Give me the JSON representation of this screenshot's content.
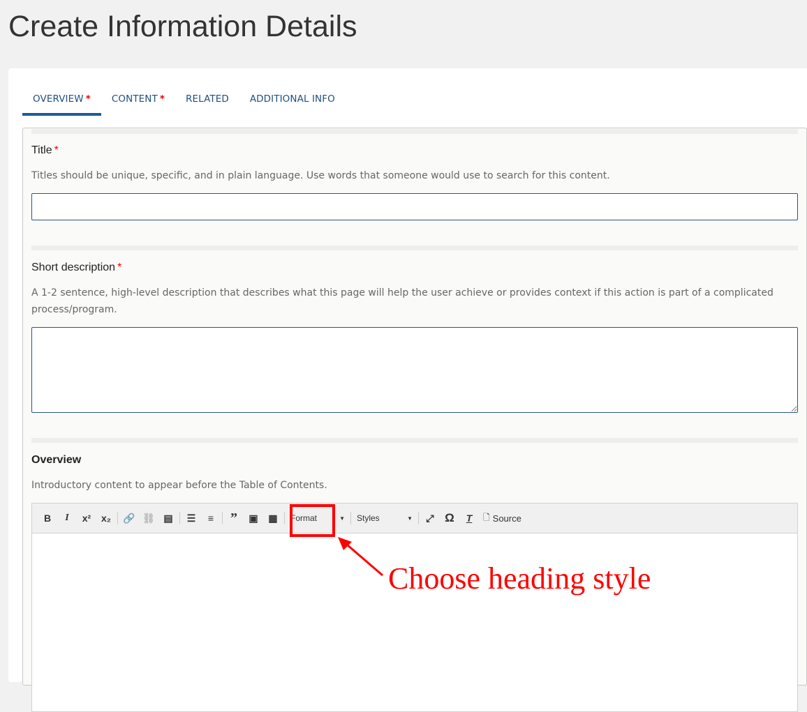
{
  "page_title": "Create Information Details",
  "tabs": [
    {
      "label": "OVERVIEW",
      "required": "*"
    },
    {
      "label": "CONTENT",
      "required": "*"
    },
    {
      "label": "RELATED"
    },
    {
      "label": "ADDITIONAL INFO"
    }
  ],
  "fields": {
    "title": {
      "label": "Title",
      "required": "*",
      "help": "Titles should be unique, specific, and in plain language. Use words that someone would use to search for this content.",
      "value": ""
    },
    "short_description": {
      "label": "Short description",
      "required": "*",
      "help": "A 1-2 sentence, high-level description that describes what this page will help the user achieve or provides context if this action is part of a complicated process/program.",
      "value": ""
    },
    "overview": {
      "label": "Overview",
      "help": "Introductory content to appear before the Table of Contents."
    }
  },
  "toolbar": {
    "bold": "B",
    "italic": "I",
    "superscript": "x²",
    "subscript": "x₂",
    "format": "Format",
    "styles": "Styles",
    "omega": "Ω",
    "source": "Source"
  },
  "annotation": {
    "text": "Choose heading style",
    "color": "#ff0000"
  }
}
